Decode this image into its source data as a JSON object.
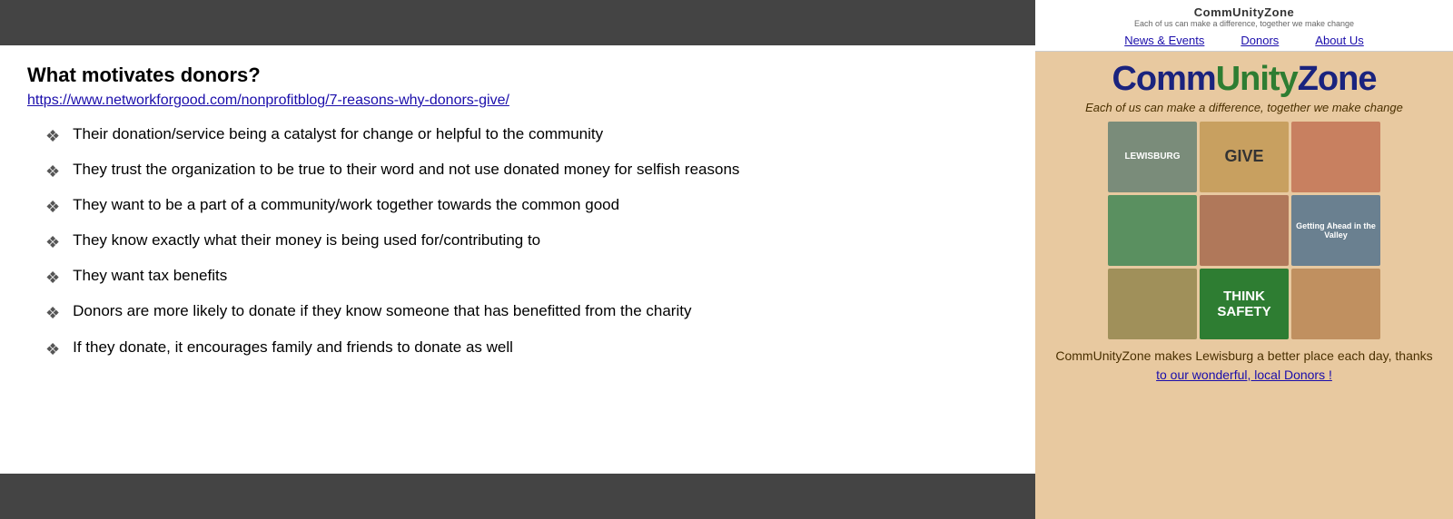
{
  "left": {
    "heading": "What motivates donors?",
    "sourceUrl": "https://www.networkforgood.com/nonprofitblog/7-reasons-why-donors-give/",
    "bullets": [
      "Their donation/service being a catalyst for change or helpful to the community",
      "They trust the organization to be true to their word and not use donated money for selfish reasons",
      "They want to be a part of a community/work together towards the common good",
      "They know exactly what their money is being used for/contributing to",
      "They want tax benefits",
      "Donors are more likely to donate if they know someone that has benefitted from the charity",
      "If they donate, it encourages family and friends to donate as well"
    ]
  },
  "right": {
    "logoText": "CommUnityZone",
    "logoSub": "Each of us can make a difference, together we make change",
    "nav": {
      "newsEvents": "News & Events",
      "donors": "Donors",
      "aboutUs": "About Us"
    },
    "brandTitle1": "Comm",
    "brandUnity": "Unity",
    "brandTitle2": "Zone",
    "brandTagline": "Each of us can make a difference, together we make change",
    "photoCells": [
      {
        "label": "LEWISBURG",
        "type": "lewisburg"
      },
      {
        "label": "GIVE",
        "type": "give-jar"
      },
      {
        "label": "",
        "type": "kids-crafts"
      },
      {
        "label": "",
        "type": "donor-figure"
      },
      {
        "label": "",
        "type": "group-photo"
      },
      {
        "label": "Getting Ahead in the Valley",
        "type": "getting-ahead"
      },
      {
        "label": "",
        "type": "healthy-soil"
      },
      {
        "label": "THINK SAFETY",
        "type": "think-safety"
      },
      {
        "label": "",
        "type": "kids-group"
      }
    ],
    "caption": "CommUnityZone makes Lewisburg a better  place each day, thanks",
    "captionLinkText": "to our wonderful, local Donors !",
    "captionLinkUrl": "#"
  }
}
